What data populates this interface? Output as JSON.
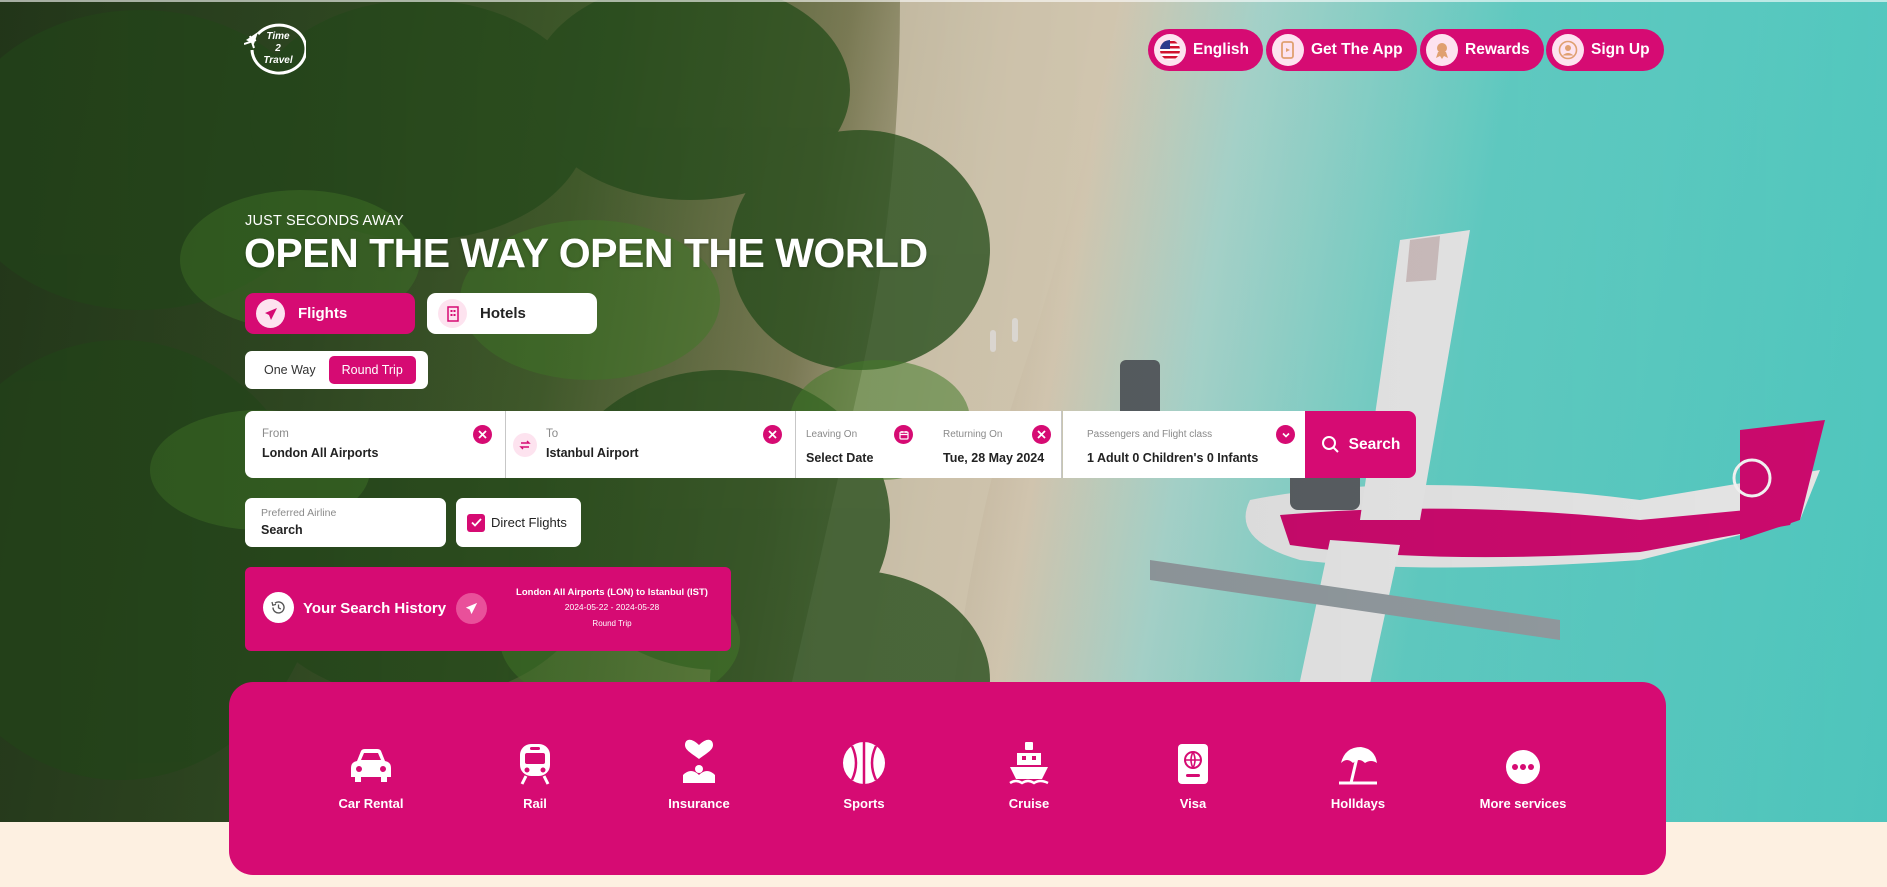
{
  "brand": {
    "logo_text": [
      "Time",
      "2",
      "Travel"
    ]
  },
  "header": {
    "nav": [
      {
        "label": "English",
        "icon": "us-flag-icon"
      },
      {
        "label": "Get The App",
        "icon": "phone-app-icon"
      },
      {
        "label": "Rewards",
        "icon": "rewards-icon"
      },
      {
        "label": "Sign Up",
        "icon": "user-icon"
      }
    ]
  },
  "hero": {
    "eyebrow": "JUST SECONDS AWAY",
    "headline": "OPEN THE WAY OPEN THE WORLD"
  },
  "tabs": [
    {
      "label": "Flights",
      "icon": "plane-icon",
      "active": true
    },
    {
      "label": "Hotels",
      "icon": "building-icon",
      "active": false
    }
  ],
  "trip_type": {
    "options": [
      "One Way",
      "Round Trip"
    ],
    "selected": "Round Trip"
  },
  "search": {
    "from": {
      "label": "From",
      "value": "London All Airports"
    },
    "to": {
      "label": "To",
      "value": "Istanbul Airport"
    },
    "leaving": {
      "label": "Leaving On",
      "value": "Select Date"
    },
    "returning": {
      "label": "Returning On",
      "value": "Tue, 28 May 2024"
    },
    "passengers": {
      "label": "Passengers and Flight class",
      "value": "1 Adult 0 Children's 0 Infants"
    },
    "button": "Search"
  },
  "filters": {
    "airline": {
      "label": "Preferred Airline",
      "value": "Search"
    },
    "direct_flights": {
      "label": "Direct Flights",
      "checked": true
    }
  },
  "history": {
    "title": "Your Search History",
    "items": [
      {
        "route": "London All Airports (LON) to Istanbul (IST)",
        "dates": "2024-05-22 - 2024-05-28",
        "type": "Round Trip"
      }
    ]
  },
  "services": [
    {
      "label": "Car Rental",
      "icon": "car-icon"
    },
    {
      "label": "Rail",
      "icon": "train-icon"
    },
    {
      "label": "Insurance",
      "icon": "insurance-heart-icon"
    },
    {
      "label": "Sports",
      "icon": "basketball-icon"
    },
    {
      "label": "Cruise",
      "icon": "ship-icon"
    },
    {
      "label": "Visa",
      "icon": "passport-icon"
    },
    {
      "label": "Holldays",
      "icon": "beach-umbrella-icon"
    },
    {
      "label": "More services",
      "icon": "more-dots-icon"
    }
  ],
  "colors": {
    "accent": "#d60b73",
    "accent_light": "#fde3ef",
    "footer_bg": "#fdf0e1"
  }
}
